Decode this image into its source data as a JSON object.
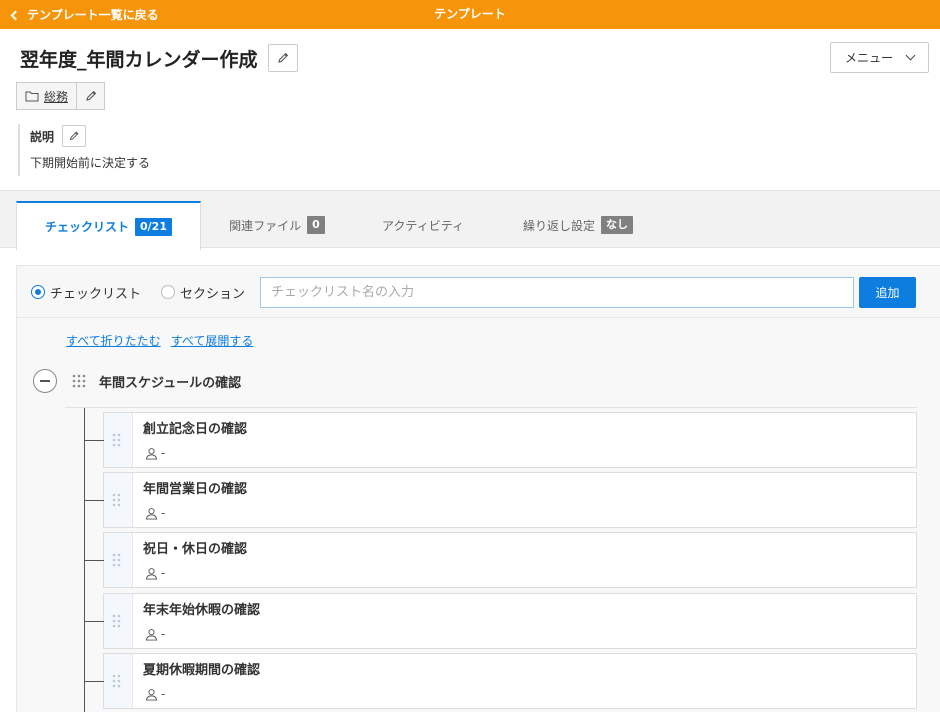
{
  "topbar": {
    "back_label": "テンプレート一覧に戻る",
    "title": "テンプレート"
  },
  "header": {
    "title": "翌年度_年間カレンダー作成",
    "menu_label": "メニュー",
    "category": "総務",
    "description_label": "説明",
    "description": "下期開始前に決定する"
  },
  "tabs": [
    {
      "label": "チェックリスト",
      "badge": "0/21",
      "active": true
    },
    {
      "label": "関連ファイル",
      "badge": "0",
      "active": false
    },
    {
      "label": "アクティビティ",
      "badge": "",
      "active": false
    },
    {
      "label": "繰り返し設定",
      "badge": "なし",
      "active": false
    }
  ],
  "add_bar": {
    "radio_checklist": "チェックリスト",
    "radio_section": "セクション",
    "input_placeholder": "チェックリスト名の入力",
    "input_value": "",
    "add_label": "追加"
  },
  "toggles": {
    "collapse_all": "すべて折りたたむ",
    "expand_all": "すべて展開する"
  },
  "section": {
    "title": "年間スケジュールの確認",
    "items": [
      {
        "title": "創立記念日の確認",
        "assignee": "-"
      },
      {
        "title": "年間営業日の確認",
        "assignee": "-"
      },
      {
        "title": "祝日・休日の確認",
        "assignee": "-"
      },
      {
        "title": "年末年始休暇の確認",
        "assignee": "-"
      },
      {
        "title": "夏期休暇期間の確認",
        "assignee": "-"
      }
    ]
  },
  "colors": {
    "topbar": "#f7950a",
    "accent": "#0e7de0",
    "badge_inactive": "#808080"
  }
}
